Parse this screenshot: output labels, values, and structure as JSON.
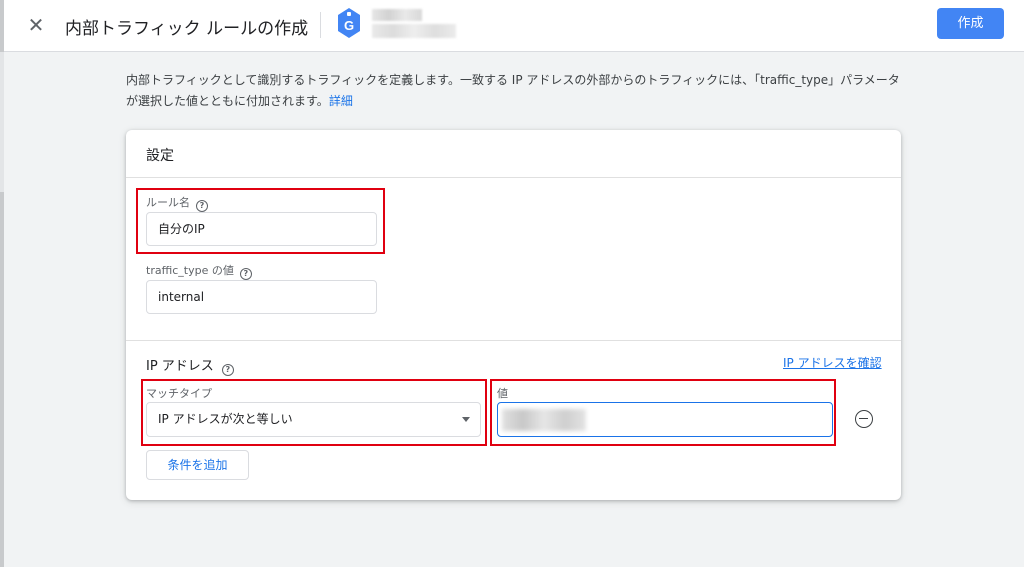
{
  "header": {
    "close_icon": "close-icon",
    "title": "内部トラフィック ルールの作成",
    "tag_icon": "google-tag-icon",
    "tag_letter": "G",
    "create_label": "作成"
  },
  "description": {
    "text": "内部トラフィックとして識別するトラフィックを定義します。一致する IP アドレスの外部からのトラフィックには、「traffic_type」パラメータが選択した値とともに付加されます。",
    "link": "詳細"
  },
  "card": {
    "title": "設定",
    "rule_name": {
      "label": "ルール名",
      "value": "自分のIP"
    },
    "traffic_type": {
      "label": "traffic_type の値",
      "value": "internal"
    },
    "ip_section": {
      "title": "IP アドレス",
      "verify_link": "IP アドレスを確認",
      "match_type": {
        "label": "マッチタイプ",
        "selected": "IP アドレスが次と等しい"
      },
      "value": {
        "label": "値",
        "value": ""
      },
      "add_condition_label": "条件を追加"
    }
  },
  "colors": {
    "accent": "#1a73e8",
    "primary_button": "#4285f4",
    "highlight": "#e00010",
    "background": "#f1f3f4"
  }
}
